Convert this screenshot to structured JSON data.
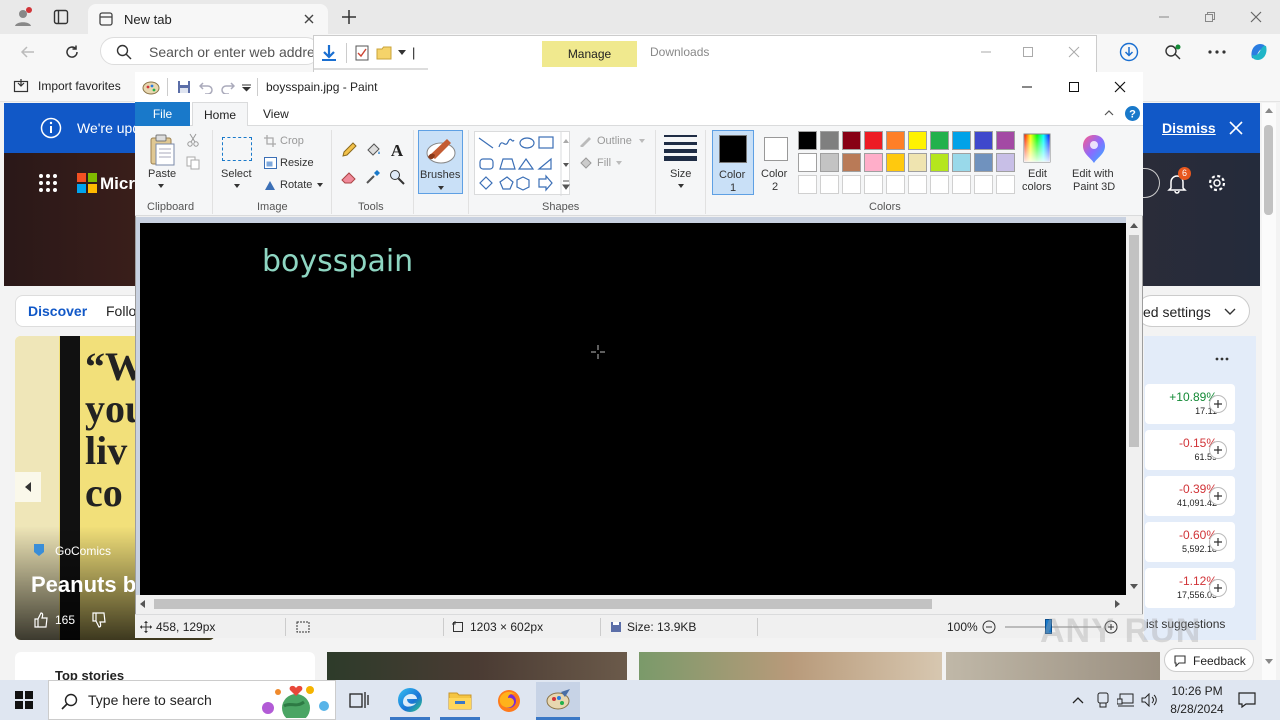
{
  "browser": {
    "tab_title": "New tab",
    "address_placeholder": "Search or enter web address",
    "favorites_import": "Import favorites",
    "banner_text": "We're upd",
    "banner_dismiss": "Dismiss",
    "brand": "Micr",
    "discover_tab": "Discover",
    "following_tab": "Follo",
    "settings_label": "ed settings",
    "comic_source": "GoComics",
    "comic_title": "Peanuts b",
    "comic_likes": "165",
    "comic_caption": "\"W you liv co",
    "notifications_count": "6",
    "top_stories": "Top stories",
    "feedback": "Feedback",
    "suggestions": "ist suggestions",
    "stocks": [
      {
        "change": "+10.89%",
        "price": "17.11",
        "color": "#138a36"
      },
      {
        "change": "-0.15%",
        "price": "61.59",
        "color": "#d13438"
      },
      {
        "change": "-0.39%",
        "price": "41,091.42",
        "color": "#d13438"
      },
      {
        "change": "-0.60%",
        "price": "5,592.18",
        "color": "#d13438"
      },
      {
        "change": "-1.12%",
        "price": "17,556.03",
        "color": "#d13438"
      }
    ]
  },
  "explorer": {
    "manage": "Manage",
    "downloads": "Downloads",
    "path_cursor": "|"
  },
  "paint": {
    "title": "boysspain.jpg - Paint",
    "tabs": {
      "file": "File",
      "home": "Home",
      "view": "View"
    },
    "clipboard": {
      "paste": "Paste",
      "group": "Clipboard"
    },
    "image": {
      "select": "Select",
      "crop": "Crop",
      "resize": "Resize",
      "rotate": "Rotate",
      "group": "Image"
    },
    "tools": {
      "group": "Tools"
    },
    "brushes": "Brushes",
    "shapes": {
      "outline": "Outline",
      "fill": "Fill",
      "group": "Shapes"
    },
    "size": "Size",
    "color1": "Color\n1",
    "color1_a": "Color",
    "color1_b": "1",
    "color2_a": "Color",
    "color2_b": "2",
    "colors_group": "Colors",
    "edit_colors_a": "Edit",
    "edit_colors_b": "colors",
    "edit3d_a": "Edit with",
    "edit3d_b": "Paint 3D",
    "canvas_text": "boysspain",
    "status": {
      "cursor_pos": "458, 129px",
      "dimensions": "1203 × 602px",
      "size": "Size: 13.9KB",
      "zoom": "100%"
    },
    "palette_row1": [
      "#000000",
      "#7f7f7f",
      "#880015",
      "#ed1c24",
      "#ff7f27",
      "#fff200",
      "#22b14c",
      "#00a2e8",
      "#3f48cc",
      "#a349a4"
    ],
    "palette_row2": [
      "#ffffff",
      "#c3c3c3",
      "#b97a57",
      "#ffaec9",
      "#ffc90e",
      "#efe4b0",
      "#b5e61d",
      "#99d9ea",
      "#7092be",
      "#c8bfe7"
    ]
  },
  "taskbar": {
    "search_placeholder": "Type here to search",
    "time": "10:26 PM",
    "date": "8/28/2024"
  },
  "watermark": "ANY RUN"
}
